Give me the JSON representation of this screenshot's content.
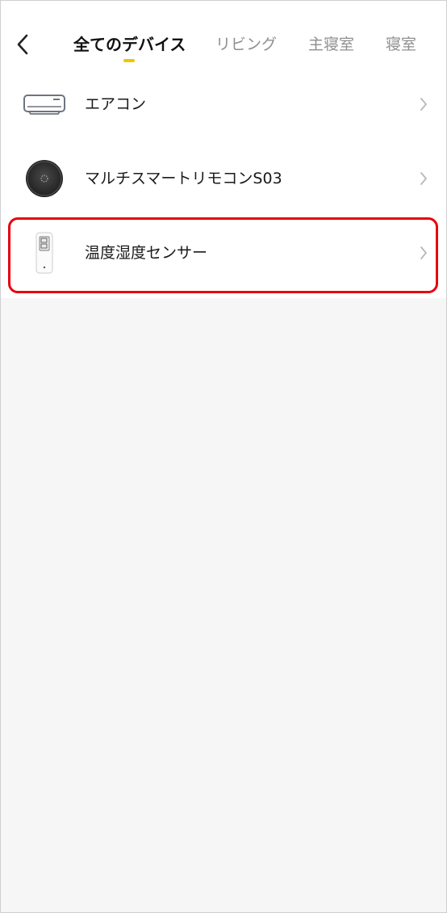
{
  "header": {
    "back_icon": "chevron-left-icon",
    "tabs": [
      {
        "label": "全てのデバイス",
        "active": true
      },
      {
        "label": "リビング",
        "active": false
      },
      {
        "label": "主寝室",
        "active": false
      },
      {
        "label": "寝室",
        "active": false
      }
    ],
    "indicator_color": "#F2C500"
  },
  "devices": [
    {
      "name": "エアコン",
      "icon": "air-conditioner-icon"
    },
    {
      "name": "マルチスマートリモコンS03",
      "icon": "smart-remote-icon"
    },
    {
      "name": "温度湿度センサー",
      "icon": "thermo-hygrometer-icon",
      "highlighted": true
    }
  ],
  "colors": {
    "highlight": "#E8000B",
    "background": "#F6F6F6",
    "active_tab": "#111111",
    "inactive_tab": "#8F8F8F"
  }
}
